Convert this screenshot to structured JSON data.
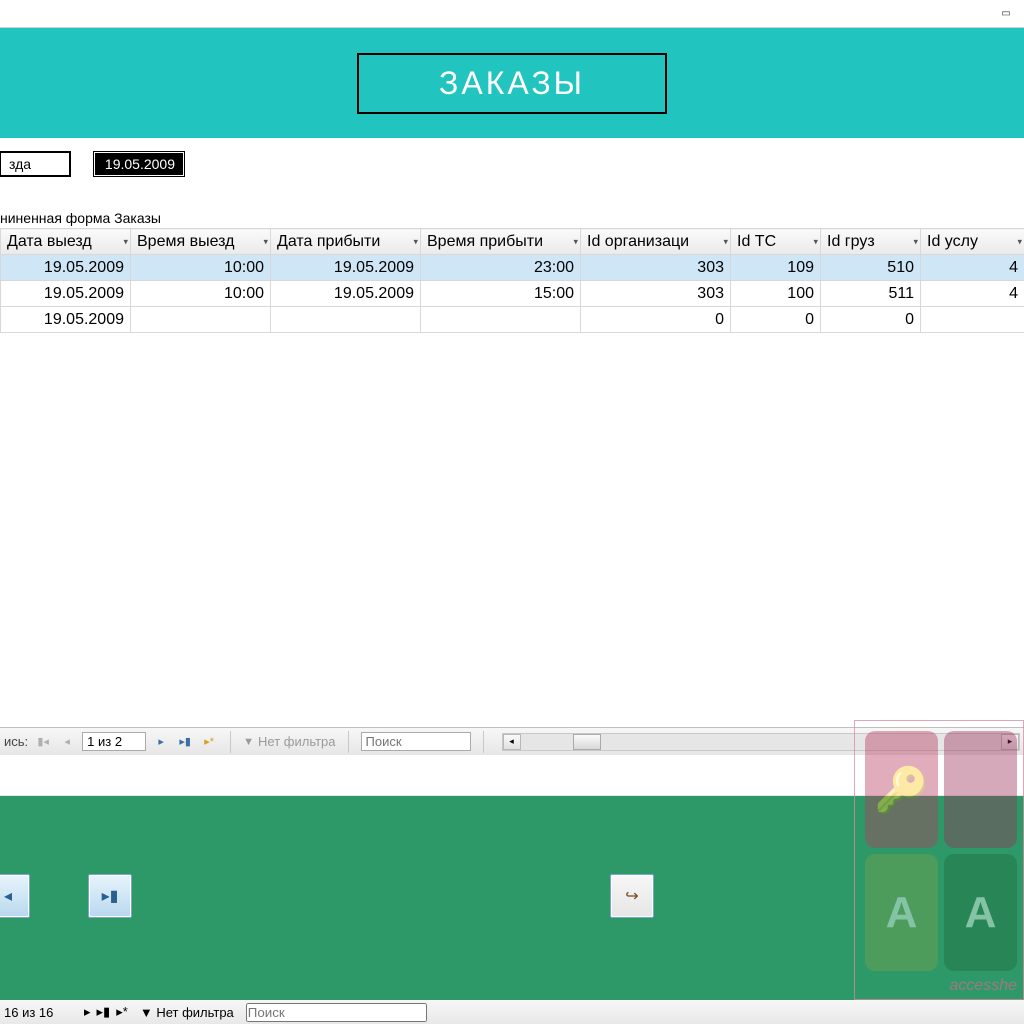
{
  "header": {
    "title": "ЗАКАЗЫ"
  },
  "filter": {
    "field_label": "зда",
    "field_value": "19.05.2009"
  },
  "subform_caption": "ниненная форма Заказы",
  "grid": {
    "columns": [
      "Дата выезд",
      "Время выезд",
      "Дата прибыти",
      "Время прибыти",
      "Id организаци",
      "Id ТС",
      "Id груз",
      "Id услу"
    ],
    "rows": [
      {
        "sel": true,
        "c": [
          "19.05.2009",
          "10:00",
          "19.05.2009",
          "23:00",
          "303",
          "109",
          "510",
          "4"
        ]
      },
      {
        "sel": false,
        "c": [
          "19.05.2009",
          "10:00",
          "19.05.2009",
          "15:00",
          "303",
          "100",
          "511",
          "4"
        ]
      },
      {
        "sel": false,
        "c": [
          "19.05.2009",
          "",
          "",
          "",
          "0",
          "0",
          "0",
          ""
        ]
      }
    ]
  },
  "innerNav": {
    "label": "ись:",
    "recordText": "1 из 2",
    "filterLabel": "Нет фильтра",
    "searchPlaceholder": "Поиск"
  },
  "outerNav": {
    "recordText": "16 из 16",
    "filterLabel": "Нет фильтра",
    "searchPlaceholder": "Поиск"
  },
  "watermark": {
    "caption": "accesshe"
  },
  "nav_glyphs": {
    "first": "▮◂",
    "prev": "◂",
    "next": "▸",
    "last": "▸▮",
    "new": "▸*",
    "minimize": "▭",
    "scroll_left": "◂",
    "scroll_right": "▸",
    "exit": "↪"
  }
}
